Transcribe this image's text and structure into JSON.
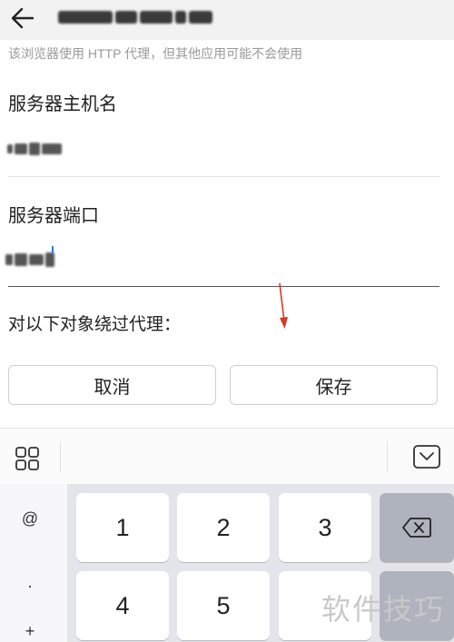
{
  "header": {
    "title_redacted": true
  },
  "hint": "该浏览器使用 HTTP 代理，但其他应用可能不会使用",
  "fields": {
    "host_label": "服务器主机名",
    "port_label": "服务器端口",
    "bypass_label": "对以下对象绕过代理："
  },
  "buttons": {
    "cancel": "取消",
    "save": "保存"
  },
  "keyboard": {
    "symbols": [
      "@",
      ".",
      "+"
    ],
    "keys": [
      "1",
      "2",
      "3",
      "4",
      "5"
    ]
  },
  "watermark": "软件技巧",
  "colors": {
    "annotation_arrow": "#d23a2a",
    "cursor": "#2b7fe0"
  }
}
